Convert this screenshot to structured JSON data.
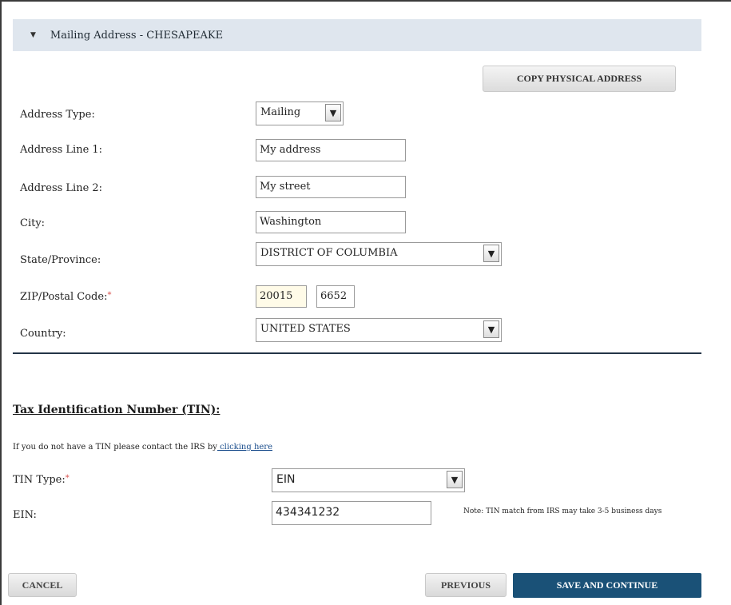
{
  "section": {
    "title": "Mailing Address - CHESAPEAKE",
    "copy_button": "COPY PHYSICAL ADDRESS"
  },
  "address": {
    "type_label": "Address Type:",
    "type_value": "Mailing",
    "line1_label": "Address Line 1:",
    "line1_value": "My address",
    "line2_label": "Address Line 2:",
    "line2_value": "My street",
    "city_label": "City:",
    "city_value": "Washington",
    "state_label": "State/Province:",
    "state_value": "DISTRICT OF COLUMBIA",
    "zip_label": "ZIP/Postal Code:",
    "zip_value": "20015",
    "zip_ext_value": "6652",
    "country_label": "Country:",
    "country_value": "UNITED STATES",
    "required_marker": "*"
  },
  "tin": {
    "title": "Tax Identification Number (TIN):",
    "note_prefix": "If you do not have a TIN please contact the IRS by",
    "note_link": " clicking here",
    "type_label": "TIN Type:",
    "type_value": "EIN",
    "ein_label": "EIN:",
    "ein_value": "434341232",
    "match_note": "Note: TIN match from IRS may take 3-5 business days"
  },
  "footer": {
    "cancel": "CANCEL",
    "previous": "PREVIOUS",
    "save_continue": "SAVE AND CONTINUE"
  },
  "icons": {
    "caret": "▼",
    "dropdown": "⌄"
  }
}
